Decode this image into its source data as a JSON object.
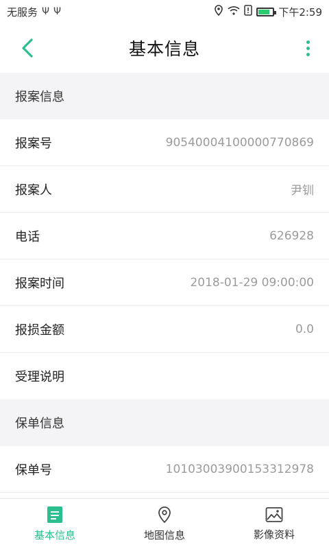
{
  "status_bar": {
    "carrier": "无服务",
    "usb1": "Ψ",
    "usb2": "Ψ",
    "time": "下午2:59",
    "battery_level": 0.7
  },
  "navbar": {
    "title": "基本信息",
    "back_icon": "chevron-left-icon",
    "more_icon": "more-vertical-icon"
  },
  "colors": {
    "accent": "#2bbf8f",
    "section_bg": "#f4f4f6",
    "value_text": "#9b9b9b"
  },
  "sections": [
    {
      "header": "报案信息",
      "rows": [
        {
          "label": "报案号",
          "value": "90540004100000770869"
        },
        {
          "label": "报案人",
          "value": "尹钏"
        },
        {
          "label": "电话",
          "value": "626928"
        },
        {
          "label": "报案时间",
          "value": "2018-01-29 09:00:00"
        },
        {
          "label": "报损金额",
          "value": "0.0"
        },
        {
          "label": "受理说明",
          "value": ""
        }
      ]
    },
    {
      "header": "保单信息",
      "rows": [
        {
          "label": "保单号",
          "value": "10103003900153312978"
        }
      ]
    }
  ],
  "tabbar": {
    "tabs": [
      {
        "label": "基本信息",
        "icon": "document-icon",
        "active": true
      },
      {
        "label": "地图信息",
        "icon": "map-pin-icon",
        "active": false
      },
      {
        "label": "影像资料",
        "icon": "image-icon",
        "active": false
      }
    ]
  }
}
